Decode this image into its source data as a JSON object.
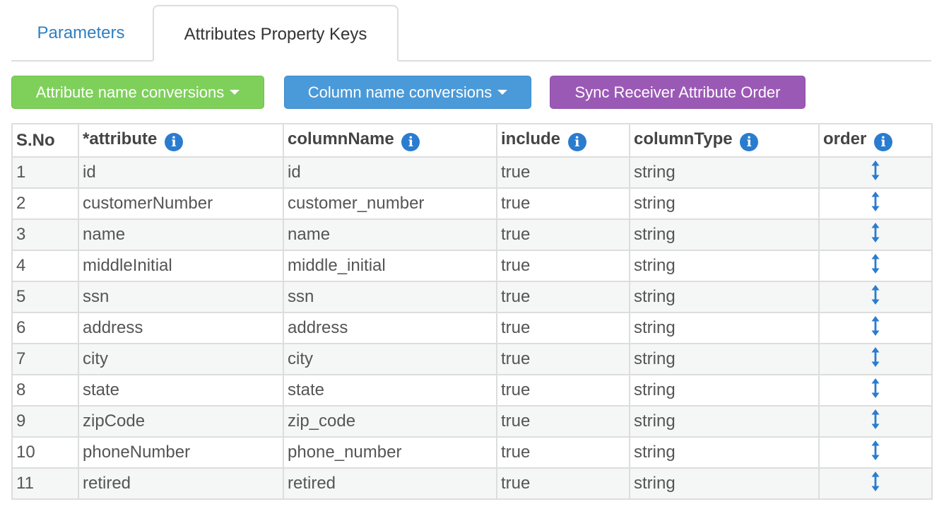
{
  "tabs": [
    {
      "label": "Parameters"
    },
    {
      "label": "Attributes Property Keys"
    }
  ],
  "buttons": {
    "attribute_conversions": "Attribute name conversions",
    "column_conversions": "Column name conversions",
    "sync_order": "Sync Receiver Attribute Order"
  },
  "colors": {
    "green": "#7ed05a",
    "blue": "#4a9ad9",
    "purple": "#9b59b6",
    "info": "#2a7ccf"
  },
  "table": {
    "headers": [
      "S.No",
      "*attribute",
      "columnName",
      "include",
      "columnType",
      "order"
    ],
    "info_icon": "i",
    "rows": [
      [
        "1",
        "id",
        "id",
        "true",
        "string"
      ],
      [
        "2",
        "customerNumber",
        "customer_number",
        "true",
        "string"
      ],
      [
        "3",
        "name",
        "name",
        "true",
        "string"
      ],
      [
        "4",
        "middleInitial",
        "middle_initial",
        "true",
        "string"
      ],
      [
        "5",
        "ssn",
        "ssn",
        "true",
        "string"
      ],
      [
        "6",
        "address",
        "address",
        "true",
        "string"
      ],
      [
        "7",
        "city",
        "city",
        "true",
        "string"
      ],
      [
        "8",
        "state",
        "state",
        "true",
        "string"
      ],
      [
        "9",
        "zipCode",
        "zip_code",
        "true",
        "string"
      ],
      [
        "10",
        "phoneNumber",
        "phone_number",
        "true",
        "string"
      ],
      [
        "11",
        "retired",
        "retired",
        "true",
        "string"
      ]
    ]
  }
}
